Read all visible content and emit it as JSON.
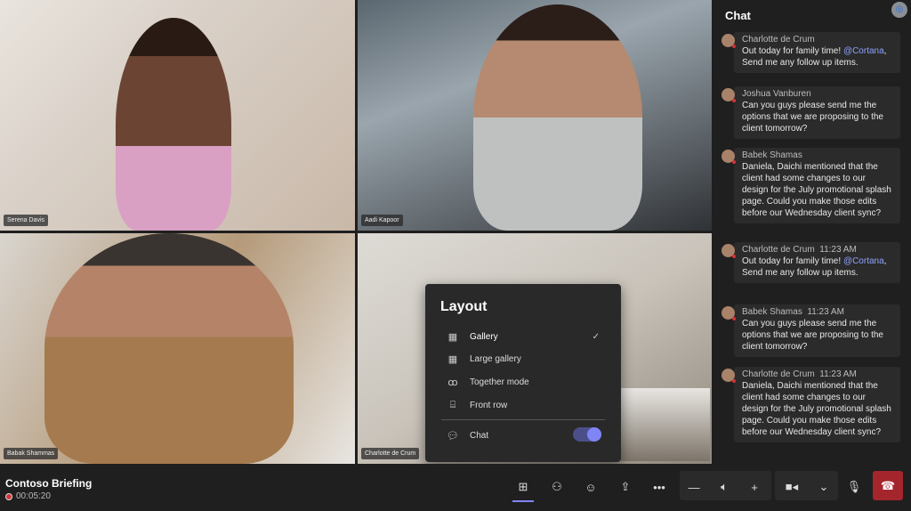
{
  "tiles": [
    {
      "name": "Serena Davis"
    },
    {
      "name": "Aadi Kapoor"
    },
    {
      "name": "Babak Shammas"
    },
    {
      "name": "Charlotte de Crum"
    }
  ],
  "chat": {
    "title": "Chat",
    "messages": [
      {
        "author": "Charlotte de Crum",
        "time": "",
        "pre": "Out today for family time! ",
        "mention": "@Cortana",
        "post": ", Send me any follow up items."
      },
      {
        "author": "Joshua Vanburen",
        "time": "",
        "pre": "Can you guys please send me the options that we are proposing to the client tomorrow?",
        "mention": "",
        "post": ""
      },
      {
        "author": "Babek Shamas",
        "time": "",
        "pre": "Daniela, Daichi mentioned that the client had some changes to our design for the July promotional splash page. Could you make those edits before our Wednesday client sync?",
        "mention": "",
        "post": ""
      },
      {
        "author": "Charlotte de Crum",
        "time": "11:23 AM",
        "pre": "Out today for family time! ",
        "mention": "@Cortana",
        "post": ", Send me any follow up items."
      },
      {
        "author": "Babek Shamas",
        "time": "11:23 AM",
        "pre": "Can you guys please send me the options that we are proposing to the client tomorrow?",
        "mention": "",
        "post": ""
      },
      {
        "author": "Charlotte de Crum",
        "time": "11:23 AM",
        "pre": "Daniela, Daichi mentioned that the client had some changes to our design for the July promotional splash page. Could you make those edits before our Wednesday client sync?",
        "mention": "",
        "post": ""
      }
    ]
  },
  "layout_menu": {
    "title": "Layout",
    "items": [
      {
        "label": "Gallery",
        "selected": true
      },
      {
        "label": "Large gallery"
      },
      {
        "label": "Together mode"
      },
      {
        "label": "Front row"
      }
    ],
    "chat_toggle": {
      "label": "Chat",
      "on": true
    }
  },
  "meeting": {
    "title": "Contoso Briefing",
    "elapsed": "00:05:20"
  },
  "colors": {
    "accent": "#7f85f5",
    "hangup": "#a4262c",
    "recording": "#d13438"
  }
}
